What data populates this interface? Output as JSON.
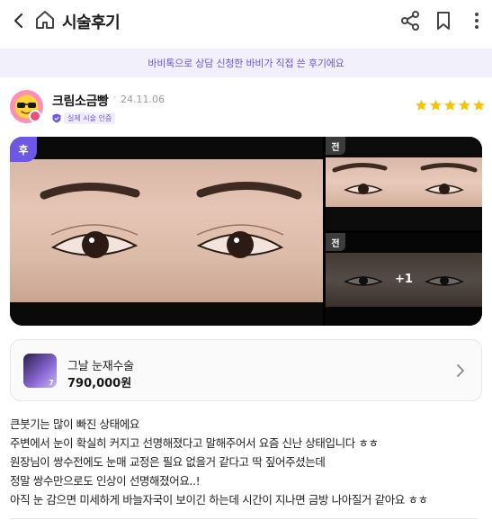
{
  "header": {
    "title": "시술후기",
    "back_icon": "chevron-left-icon",
    "home_icon": "home-icon",
    "share_icon": "share-icon",
    "bookmark_icon": "bookmark-icon",
    "more_icon": "more-vertical-icon"
  },
  "banner": {
    "text": "바비톡으로 상담 신청한 바비가 직접 쓴 후기에요",
    "color": "#6d57e8"
  },
  "review": {
    "author": "크림소금빵",
    "separator": "·",
    "date": "24.11.06",
    "verified_label": "실제 시술 인증",
    "rating": 5,
    "star_color": "#ffc107"
  },
  "photos": {
    "main_tag": "후",
    "before_tag_1": "전",
    "before_tag_2": "전",
    "more_count": "+1"
  },
  "product": {
    "name": "그날 눈재수술",
    "price": "790,000원",
    "thumb_badge": "7",
    "arrow_icon": "chevron-right-icon"
  },
  "content": {
    "lines": [
      "큰붓기는 많이 빠진 상태에요",
      "주변에서 눈이 확실히 커지고 선명해졌다고 말해주어서 요즘 신난 상태입니다 ㅎㅎ",
      "원장님이 쌍수전에도 눈매 교정은 필요 없을거 같다고 딱 짚어주셨는데",
      "정말 쌍수만으로도 인상이 선명해졌어요..!",
      "아직 눈 감으면 미세하게 바늘자국이 보이긴 하는데 시간이 지나면 금방 나아질거 같아요 ㅎㅎ"
    ]
  },
  "colors": {
    "accent": "#6d57e8",
    "banner_bg": "#f1f0fb"
  }
}
